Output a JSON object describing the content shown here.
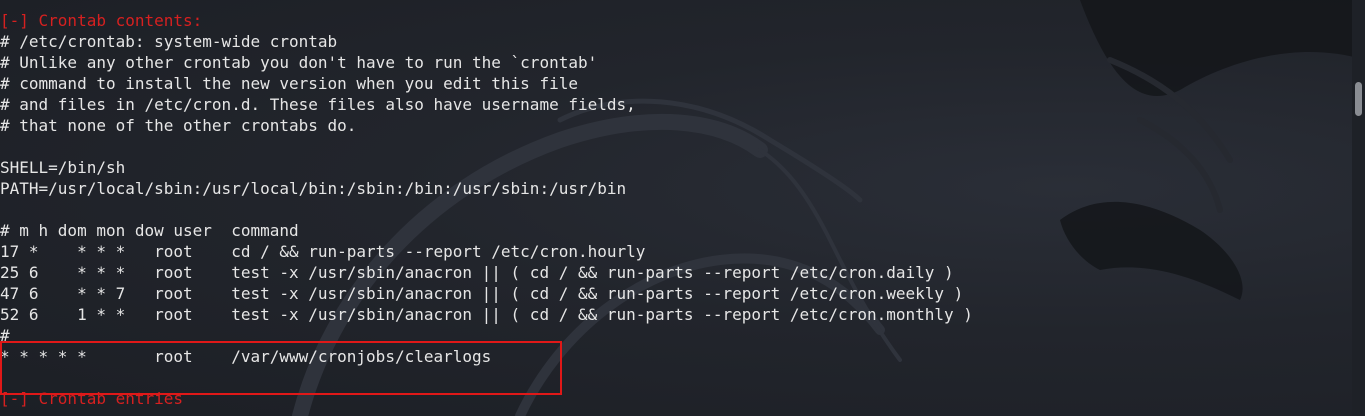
{
  "terminal": {
    "lines": [
      {
        "text": "[-] Crontab contents:",
        "color": "#d62020"
      },
      {
        "text": "# /etc/crontab: system-wide crontab"
      },
      {
        "text": "# Unlike any other crontab you don't have to run the `crontab'"
      },
      {
        "text": "# command to install the new version when you edit this file"
      },
      {
        "text": "# and files in /etc/cron.d. These files also have username fields,"
      },
      {
        "text": "# that none of the other crontabs do."
      },
      {
        "text": ""
      },
      {
        "text": "SHELL=/bin/sh"
      },
      {
        "text": "PATH=/usr/local/sbin:/usr/local/bin:/sbin:/bin:/usr/sbin:/usr/bin"
      },
      {
        "text": ""
      },
      {
        "text": "# m h dom mon dow user  command"
      },
      {
        "text": "17 *    * * *   root    cd / && run-parts --report /etc/cron.hourly"
      },
      {
        "text": "25 6    * * *   root    test -x /usr/sbin/anacron || ( cd / && run-parts --report /etc/cron.daily )"
      },
      {
        "text": "47 6    * * 7   root    test -x /usr/sbin/anacron || ( cd / && run-parts --report /etc/cron.weekly )"
      },
      {
        "text": "52 6    1 * *   root    test -x /usr/sbin/anacron || ( cd / && run-parts --report /etc/cron.monthly )"
      },
      {
        "text": "#"
      },
      {
        "text": "* * * * *       root    /var/www/cronjobs/clearlogs"
      },
      {
        "text": ""
      },
      {
        "text": "[-] Crontab entries",
        "color": "#d62020"
      }
    ],
    "highlight_color": "#e01818"
  }
}
